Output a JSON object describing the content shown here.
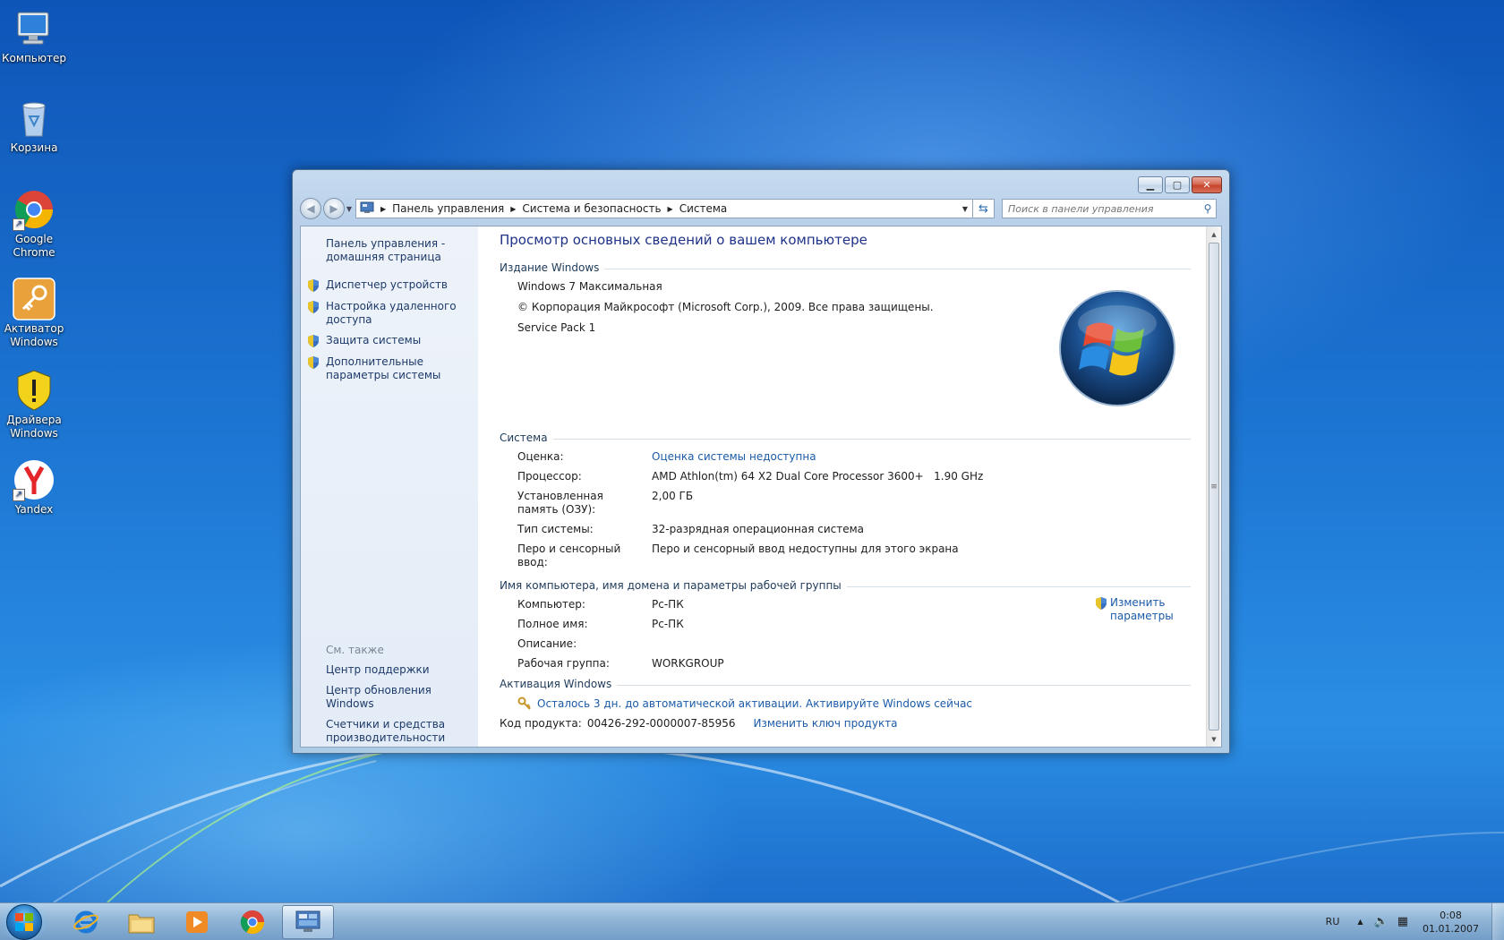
{
  "desktop": {
    "icons": [
      {
        "label": "Компьютер"
      },
      {
        "label": "Корзина"
      },
      {
        "label": "Google Chrome"
      },
      {
        "label": "Активатор Windows"
      },
      {
        "label": "Драйвера Windows"
      },
      {
        "label": "Yandex"
      }
    ]
  },
  "window": {
    "address": {
      "crumbs": [
        "Панель управления",
        "Система и безопасность",
        "Система"
      ]
    },
    "search": {
      "placeholder": "Поиск в панели управления"
    },
    "sidebar": {
      "home": "Панель управления - домашняя страница",
      "items": [
        {
          "label": "Диспетчер устройств"
        },
        {
          "label": "Настройка удаленного доступа"
        },
        {
          "label": "Защита системы"
        },
        {
          "label": "Дополнительные параметры системы"
        }
      ],
      "see_also": {
        "title": "См. также",
        "links": [
          "Центр поддержки",
          "Центр обновления Windows",
          "Счетчики и средства производительности"
        ]
      }
    },
    "main": {
      "title": "Просмотр основных сведений о вашем компьютере",
      "edition": {
        "heading": "Издание Windows",
        "name": "Windows 7 Максимальная",
        "copyright": "© Корпорация Майкрософт (Microsoft Corp.), 2009. Все права защищены.",
        "service_pack": "Service Pack 1"
      },
      "system": {
        "heading": "Система",
        "rows": [
          {
            "k": "Оценка:",
            "v": "Оценка системы недоступна"
          },
          {
            "k": "Процессор:",
            "v": "AMD Athlon(tm) 64 X2 Dual Core Processor 3600+   1.90 GHz"
          },
          {
            "k": "Установленная память (ОЗУ):",
            "v": "2,00 ГБ"
          },
          {
            "k": "Тип системы:",
            "v": "32-разрядная операционная система"
          },
          {
            "k": "Перо и сенсорный ввод:",
            "v": "Перо и сенсорный ввод недоступны для этого экрана"
          }
        ]
      },
      "computer_name": {
        "heading": "Имя компьютера, имя домена и параметры рабочей группы",
        "rows": [
          {
            "k": "Компьютер:",
            "v": "Pc-ПК"
          },
          {
            "k": "Полное имя:",
            "v": "Pc-ПК"
          },
          {
            "k": "Описание:",
            "v": ""
          },
          {
            "k": "Рабочая группа:",
            "v": "WORKGROUP"
          }
        ],
        "change_link": "Изменить параметры"
      },
      "activation": {
        "heading": "Активация Windows",
        "notice": "Осталось 3 дн. до автоматической активации. Активируйте Windows сейчас",
        "product_key_label": "Код продукта:",
        "product_key": "00426-292-0000007-85956",
        "change_key_link": "Изменить ключ продукта"
      }
    }
  },
  "taskbar": {
    "language": "RU",
    "time": "0:08",
    "date": "01.01.2007"
  },
  "colors": {
    "link": "#1b5ba8",
    "title": "#1e3287",
    "desktop": "#1a66c8"
  }
}
